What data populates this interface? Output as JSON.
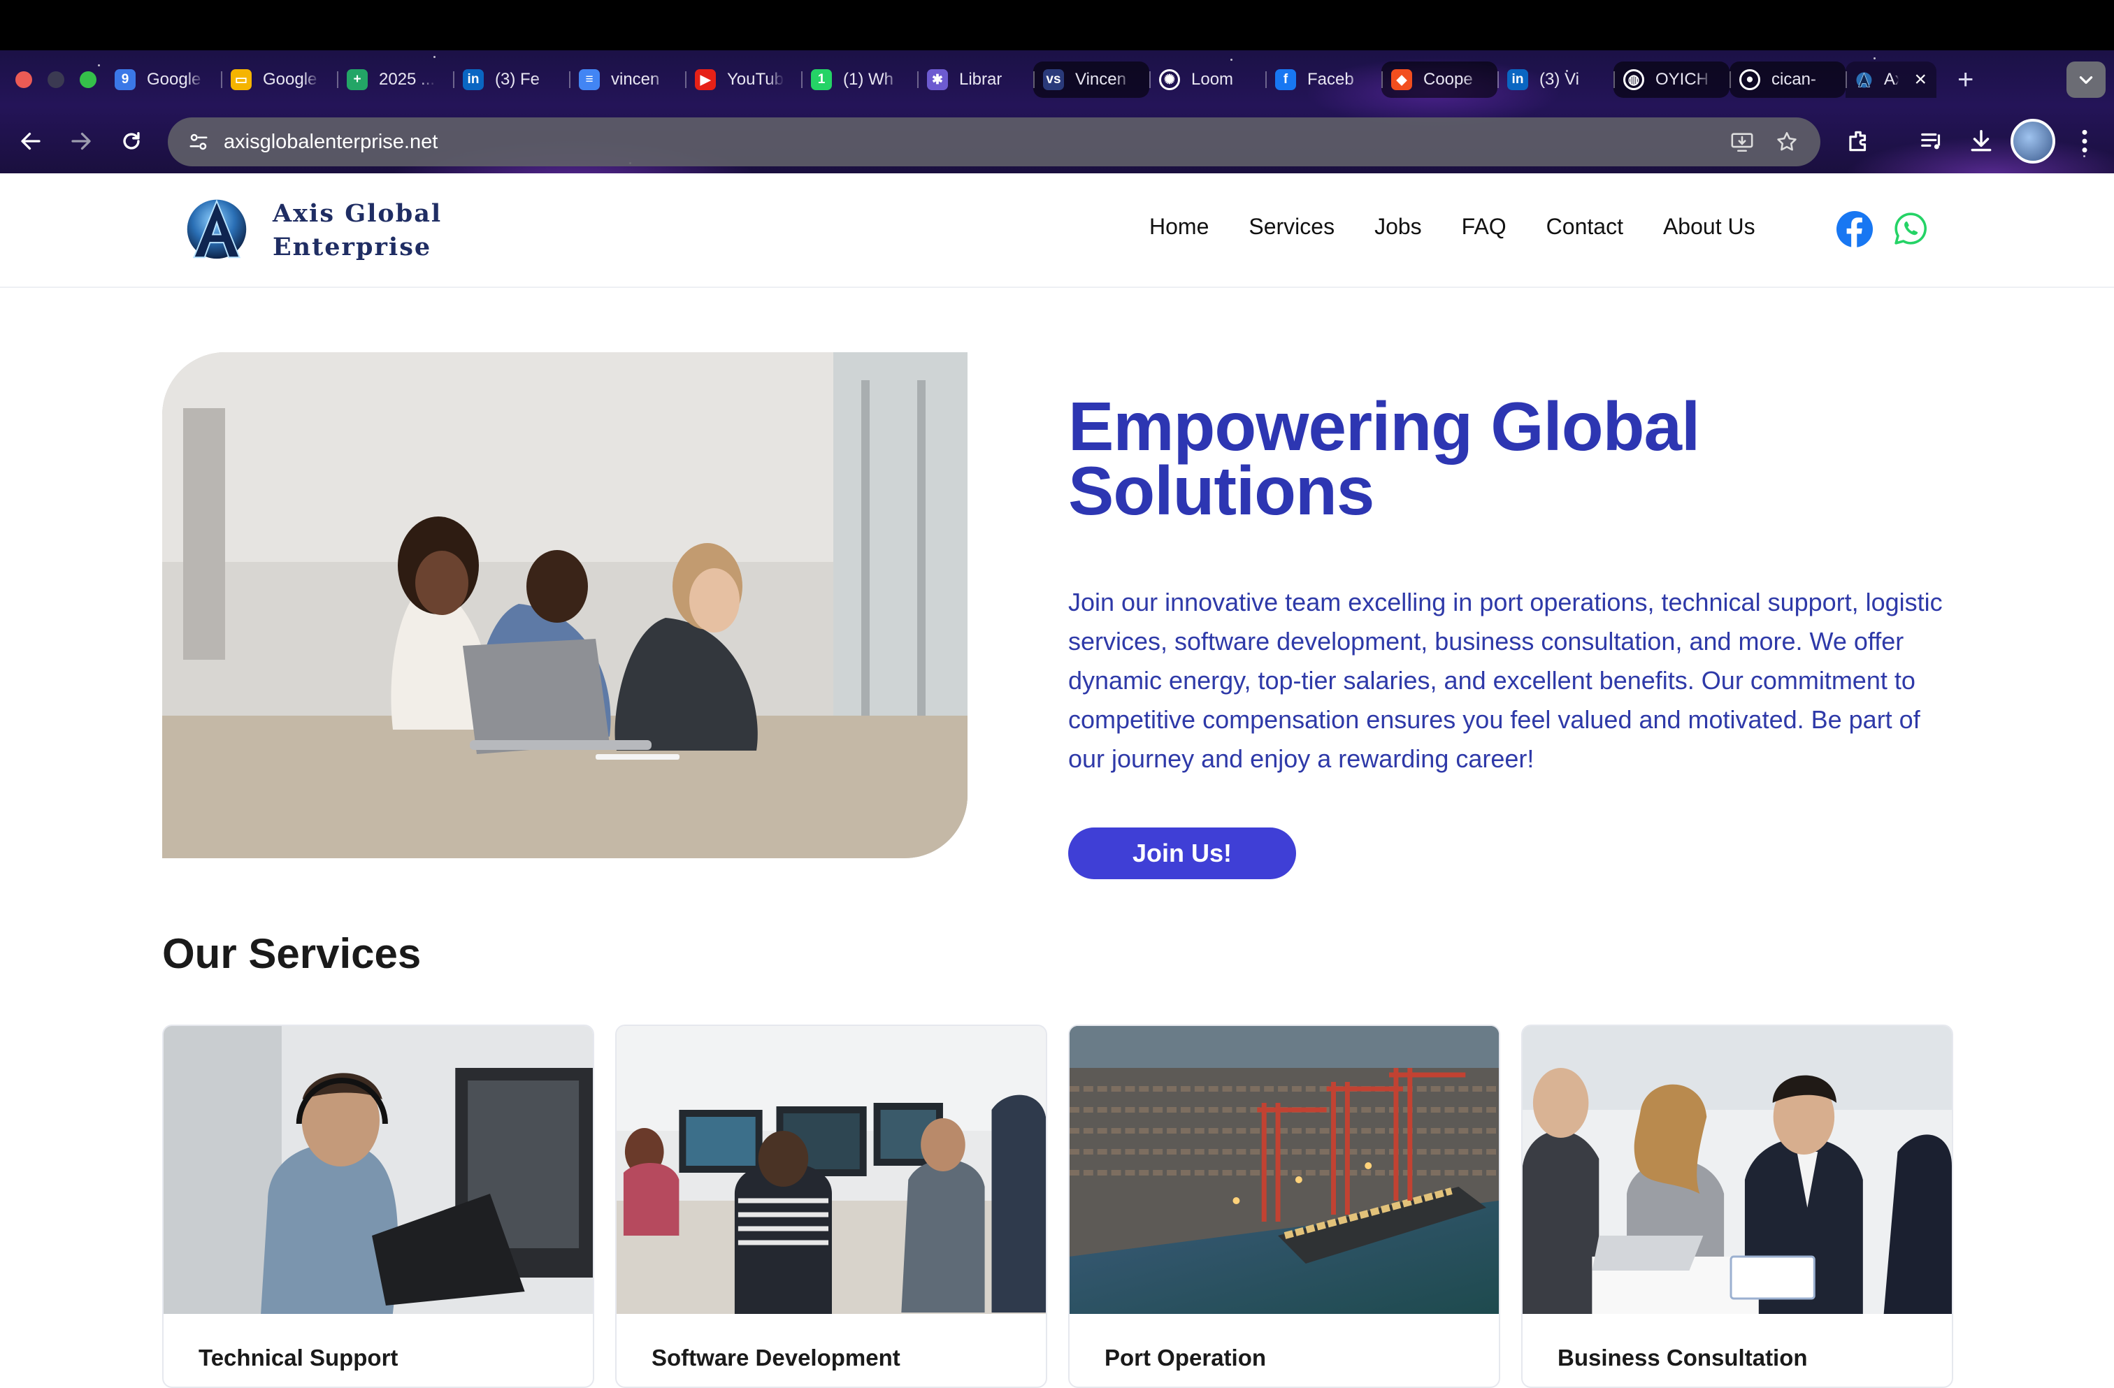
{
  "browser": {
    "tabs": [
      {
        "title": "Google",
        "icon": "google-maps-icon",
        "color": "#3b78e7",
        "glyph": "9",
        "style": "normal"
      },
      {
        "title": "Google",
        "icon": "google-slides-icon",
        "color": "#f5b400",
        "glyph": "▭",
        "style": "normal"
      },
      {
        "title": "2025 ...",
        "icon": "google-sheets-icon",
        "color": "#23a566",
        "glyph": "+",
        "style": "normal"
      },
      {
        "title": "(3) Fe",
        "icon": "linkedin-icon",
        "color": "#0a66c2",
        "glyph": "in",
        "style": "normal"
      },
      {
        "title": "vincen",
        "icon": "google-docs-icon",
        "color": "#4285f4",
        "glyph": "≡",
        "style": "normal"
      },
      {
        "title": "YouTube",
        "icon": "youtube-icon",
        "color": "#e62117",
        "glyph": "▶",
        "style": "normal"
      },
      {
        "title": "(1) Wh",
        "icon": "whatsapp-icon",
        "color": "#25d366",
        "glyph": "1",
        "style": "normal"
      },
      {
        "title": "Librar",
        "icon": "library-icon",
        "color": "#6d5bd0",
        "glyph": "✱",
        "style": "normal"
      },
      {
        "title": "Vincen",
        "icon": "vs-icon",
        "color": "#2a3a7a",
        "glyph": "vs",
        "style": "dark"
      },
      {
        "title": "Loom",
        "icon": "loom-icon",
        "color": "#ffffff",
        "glyph": "✺",
        "style": "normal"
      },
      {
        "title": "Faceb",
        "icon": "facebook-icon",
        "color": "#1877f2",
        "glyph": "f",
        "style": "normal"
      },
      {
        "title": "Coope",
        "icon": "figma-icon",
        "color": "#f24e1e",
        "glyph": "◆",
        "style": "dark"
      },
      {
        "title": "(3) Vi",
        "icon": "linkedin-icon",
        "color": "#0a66c2",
        "glyph": "in",
        "style": "normal"
      },
      {
        "title": "OYICH",
        "icon": "globe-icon",
        "color": "#ffffff",
        "glyph": "◍",
        "style": "dark"
      },
      {
        "title": "cican-",
        "icon": "github-icon",
        "color": "#ffffff",
        "glyph": "●",
        "style": "dark"
      }
    ],
    "active_tab": {
      "title": "Ax",
      "icon": "axis-logo-icon"
    },
    "url": "axisglobalenterprise.net"
  },
  "site": {
    "brand_line1": "Axis Global",
    "brand_line2": "Enterprise",
    "nav": [
      "Home",
      "Services",
      "Jobs",
      "FAQ",
      "Contact",
      "About Us"
    ],
    "colors": {
      "brand": "#1f2d63",
      "accent": "#2d36b2",
      "button": "#3f3fd6"
    }
  },
  "hero": {
    "title": "Empowering Global Solutions",
    "text": "Join our innovative team excelling in port operations, technical support, logistic services, software development, business consultation, and more. We offer dynamic energy, top-tier salaries, and excellent benefits. Our commitment to competitive compensation ensures you feel valued and motivated. Be part of our journey and enjoy a rewarding career!",
    "button": "Join Us!"
  },
  "services": {
    "heading": "Our Services",
    "items": [
      {
        "title": "Technical Support"
      },
      {
        "title": "Software Development"
      },
      {
        "title": "Port Operation"
      },
      {
        "title": "Business Consultation"
      }
    ]
  }
}
